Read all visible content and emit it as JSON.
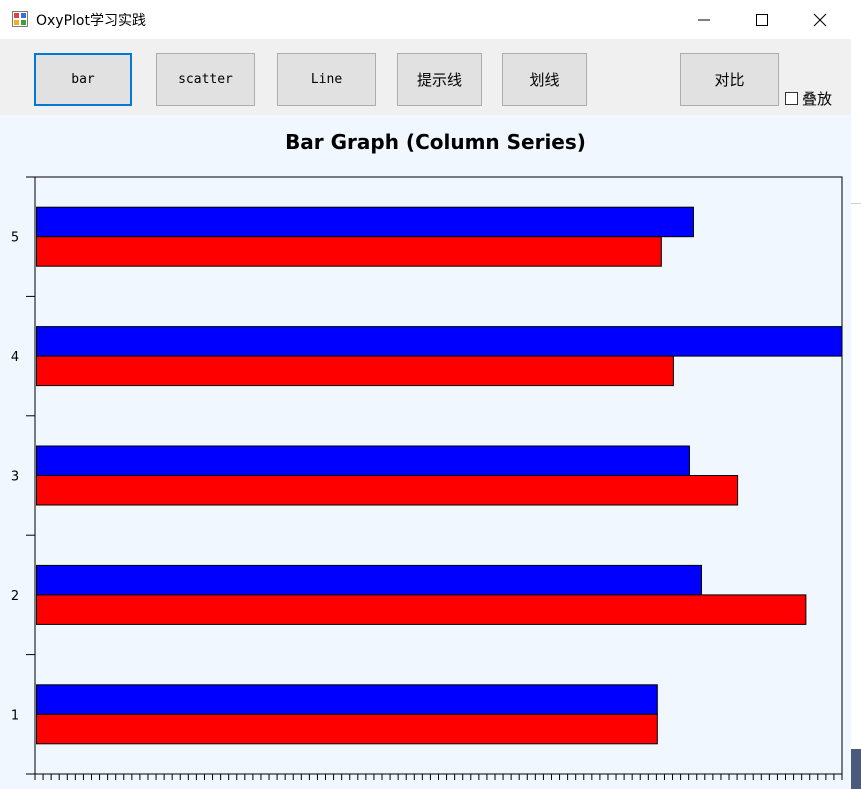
{
  "window": {
    "title": "OxyPlot学习实践"
  },
  "toolbar": {
    "buttons": [
      {
        "label": "bar"
      },
      {
        "label": "scatter"
      },
      {
        "label": "Line"
      },
      {
        "label": "提示线"
      },
      {
        "label": "划线"
      },
      {
        "label": "对比"
      }
    ],
    "stack_checkbox": {
      "label": "叠放",
      "checked": false
    }
  },
  "chart_data": {
    "type": "bar",
    "orientation": "horizontal",
    "title": "Bar Graph (Column Series)",
    "categories": [
      "1",
      "2",
      "3",
      "4",
      "5"
    ],
    "series": [
      {
        "color": "#ff0000",
        "values": [
          15.5,
          19.2,
          17.5,
          15.9,
          15.6
        ]
      },
      {
        "color": "#0000ff",
        "values": [
          15.5,
          16.6,
          16.3,
          20.1,
          16.4
        ]
      }
    ],
    "xlim": [
      0,
      20.1
    ],
    "xticks_count": 100,
    "grid": false,
    "legend": "none"
  }
}
